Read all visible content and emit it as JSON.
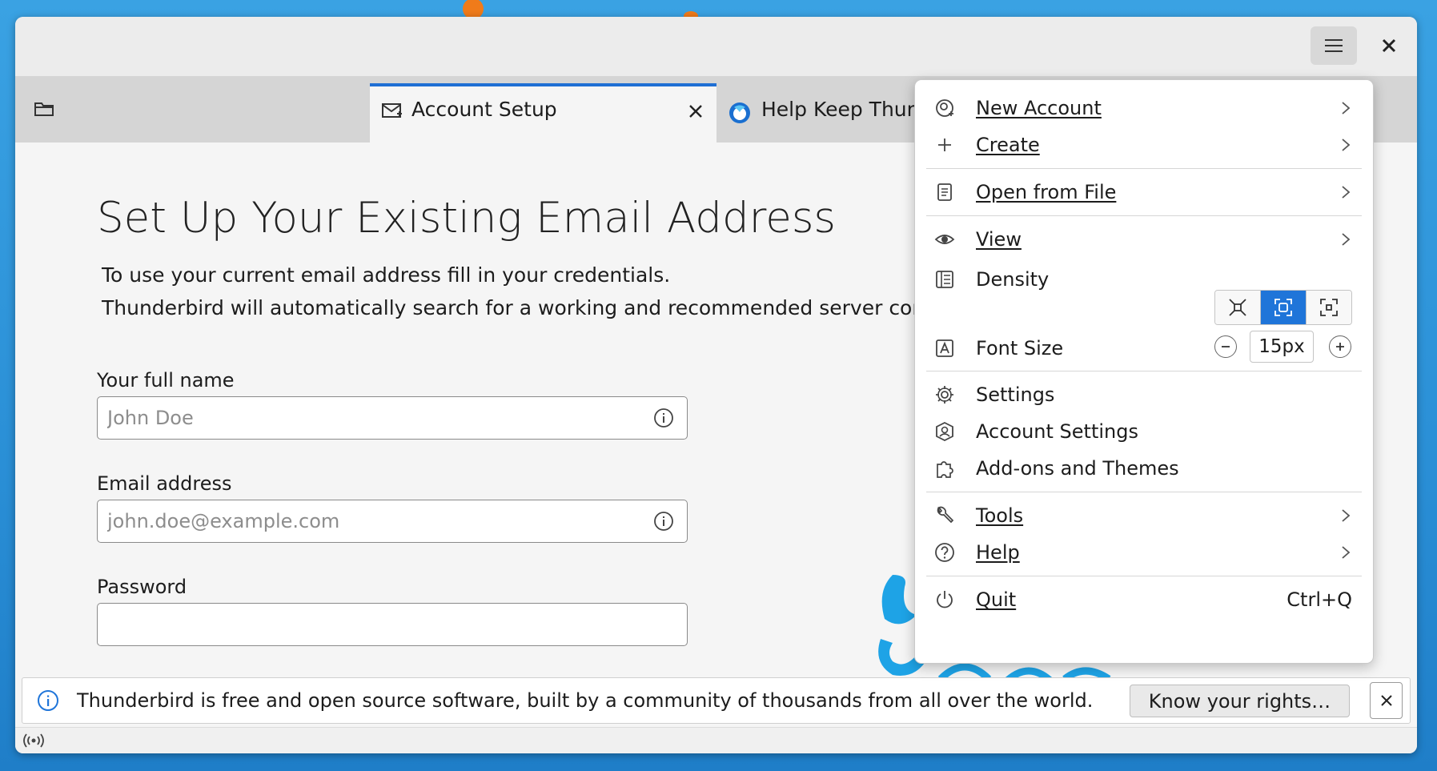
{
  "tabs": [
    {
      "label": "Account Setup",
      "active": true
    },
    {
      "label": "Help Keep Thunderbird Alive",
      "active": false
    }
  ],
  "setup": {
    "title": "Set Up Your Existing Email Address",
    "intro_line1": "To use your current email address fill in your credentials.",
    "intro_line2": "Thunderbird will automatically search for a working and recommended server configuration.",
    "fullname_label": "Your full name",
    "fullname_placeholder": "John Doe",
    "email_label": "Email address",
    "email_placeholder": "john.doe@example.com",
    "password_label": "Password"
  },
  "notification": {
    "text": "Thunderbird is free and open source software, built by a community of thousands from all over the world.",
    "button_label": "Know your rights…"
  },
  "menu": {
    "new_account": "New Account",
    "create": "Create",
    "open_from_file": "Open from File",
    "view": "View",
    "density": "Density",
    "font_size": "Font Size",
    "font_size_value": "15px",
    "settings": "Settings",
    "account_settings": "Account Settings",
    "addons": "Add-ons and Themes",
    "tools": "Tools",
    "help": "Help",
    "quit": "Quit",
    "quit_shortcut": "Ctrl+Q",
    "density_options": [
      "compact",
      "normal",
      "touch"
    ],
    "density_selected": "normal"
  },
  "colors": {
    "accent": "#1f75d9",
    "mascot": "#1ea3e6"
  }
}
